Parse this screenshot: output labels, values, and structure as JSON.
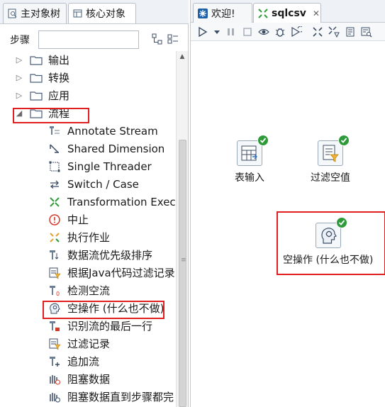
{
  "left_panel": {
    "tabs": [
      {
        "label": "主对象树",
        "icon": "tree-icon",
        "active": false
      },
      {
        "label": "核心对象",
        "icon": "core-objects-icon",
        "active": true
      }
    ],
    "steps_label": "步骤",
    "search_placeholder": "",
    "tree": {
      "folders": [
        {
          "label": "输出",
          "expanded": false
        },
        {
          "label": "转换",
          "expanded": false
        },
        {
          "label": "应用",
          "expanded": false
        },
        {
          "label": "流程",
          "expanded": true
        }
      ],
      "items": [
        {
          "label": "Annotate Stream",
          "icon": "annotate-stream-icon"
        },
        {
          "label": "Shared Dimension",
          "icon": "shared-dimension-icon"
        },
        {
          "label": "Single Threader",
          "icon": "single-threader-icon"
        },
        {
          "label": "Switch / Case",
          "icon": "switch-case-icon"
        },
        {
          "label": "Transformation Exec",
          "icon": "transformation-executor-icon"
        },
        {
          "label": "中止",
          "icon": "abort-icon"
        },
        {
          "label": "执行作业",
          "icon": "execute-job-icon"
        },
        {
          "label": "数据流优先级排序",
          "icon": "prioritize-streams-icon"
        },
        {
          "label": "根据Java代码过滤记录",
          "icon": "java-filter-icon"
        },
        {
          "label": "检测空流",
          "icon": "detect-empty-stream-icon"
        },
        {
          "label": "空操作 (什么也不做)",
          "icon": "dummy-step-icon"
        },
        {
          "label": "识别流的最后一行",
          "icon": "identify-last-row-icon"
        },
        {
          "label": "过滤记录",
          "icon": "filter-rows-icon"
        },
        {
          "label": "追加流",
          "icon": "append-streams-icon"
        },
        {
          "label": "阻塞数据",
          "icon": "blocking-step-icon"
        },
        {
          "label": "阻塞数据直到步骤都完",
          "icon": "block-until-steps-finish-icon"
        }
      ]
    }
  },
  "right_panel": {
    "tabs": [
      {
        "label": "欢迎!",
        "icon": "welcome-icon",
        "active": false
      },
      {
        "label": "sqlcsv",
        "icon": "transformation-icon",
        "active": true,
        "close": "✕"
      }
    ],
    "canvas": {
      "nodes": [
        {
          "label": "表输入",
          "icon": "table-input-icon"
        },
        {
          "label": "过滤空值",
          "icon": "filter-rows-icon"
        },
        {
          "label": "空操作 (什么也不做)",
          "icon": "dummy-step-icon"
        }
      ]
    }
  },
  "colors": {
    "highlight_box": "#e02020",
    "success_badge": "#2e9b3a",
    "folder": "#4a5f7a"
  }
}
